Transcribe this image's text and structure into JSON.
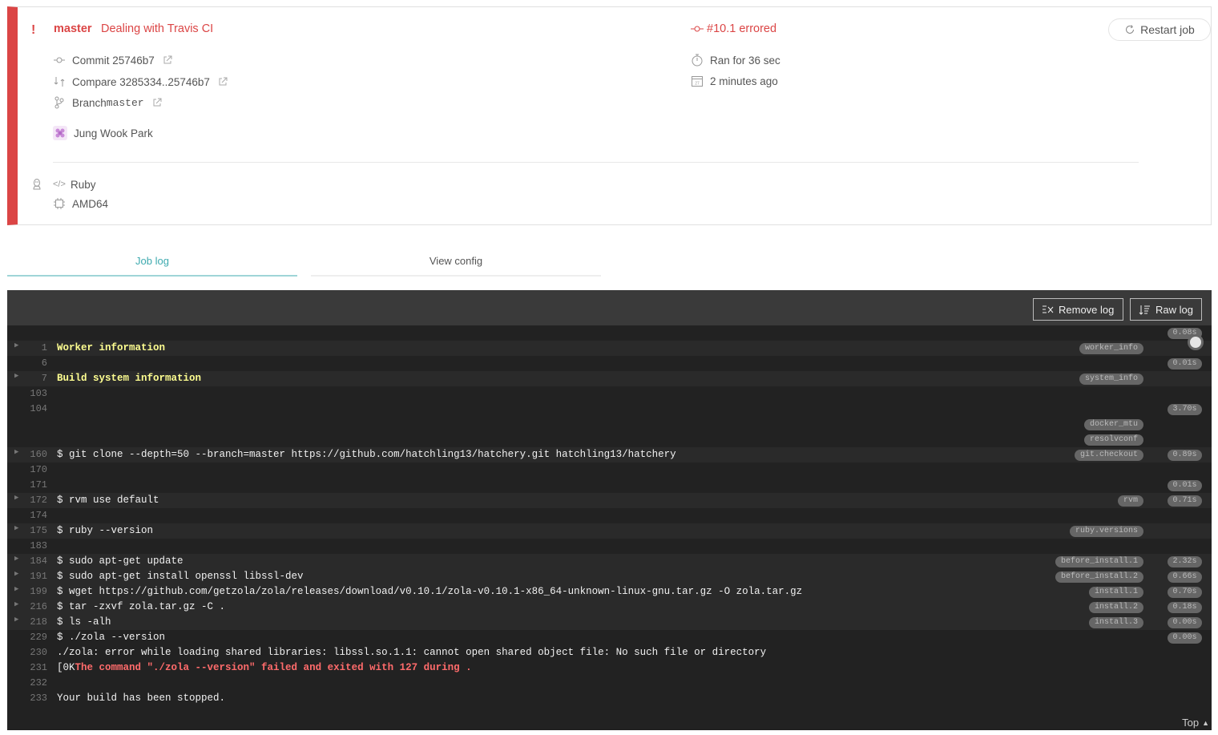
{
  "job": {
    "status_mark": "!",
    "branch": "master",
    "message": "Dealing with Travis CI",
    "number": "#10.1 errored",
    "commit_label": "Commit 25746b7",
    "compare_label": "Compare 3285334..25746b7",
    "branch_prefix": "Branch ",
    "branch_value": "master",
    "author": "Jung Wook Park",
    "duration": "Ran for 36 sec",
    "finished": "2 minutes ago",
    "language": "Ruby",
    "arch": "AMD64",
    "restart_label": "Restart job"
  },
  "colors": {
    "error": "#db4545",
    "tab_active": "#3eaaaf",
    "log_bg": "#222222"
  },
  "tabs": {
    "log": "Job log",
    "config": "View config"
  },
  "log": {
    "remove_label": "Remove log",
    "raw_label": "Raw log",
    "top_label": "Top",
    "lines": [
      {
        "n": "",
        "text": "",
        "time": "0.08s"
      },
      {
        "n": "1",
        "text": "Worker information",
        "style": "yellow",
        "fold": true,
        "tag": "worker_info"
      },
      {
        "n": "6",
        "text": "",
        "time": "0.01s"
      },
      {
        "n": "7",
        "text": "Build system information",
        "style": "yellow",
        "fold": true,
        "tag": "system_info"
      },
      {
        "n": "103",
        "text": ""
      },
      {
        "n": "104",
        "text": "",
        "time": "3.70s"
      },
      {
        "n": "",
        "text": "",
        "tag": "docker_mtu"
      },
      {
        "n": "",
        "text": "",
        "tag": "resolvconf"
      },
      {
        "n": "160",
        "text": "$ git clone --depth=50 --branch=master https://github.com/hatchling13/hatchery.git hatchling13/hatchery",
        "fold": true,
        "tag": "git.checkout",
        "time": "0.89s"
      },
      {
        "n": "170",
        "text": ""
      },
      {
        "n": "171",
        "text": "",
        "time": "0.01s"
      },
      {
        "n": "172",
        "text": "$ rvm use default",
        "fold": true,
        "tag": "rvm",
        "time": "0.71s"
      },
      {
        "n": "174",
        "text": ""
      },
      {
        "n": "175",
        "text": "$ ruby --version",
        "fold": true,
        "tag": "ruby.versions"
      },
      {
        "n": "183",
        "text": ""
      },
      {
        "n": "184",
        "text": "$ sudo apt-get update",
        "fold": true,
        "tag": "before_install.1",
        "time": "2.32s"
      },
      {
        "n": "191",
        "text": "$ sudo apt-get install openssl libssl-dev",
        "fold": true,
        "tag": "before_install.2",
        "time": "0.66s"
      },
      {
        "n": "199",
        "text": "$ wget https://github.com/getzola/zola/releases/download/v0.10.1/zola-v0.10.1-x86_64-unknown-linux-gnu.tar.gz -O zola.tar.gz",
        "fold": true,
        "tag": "install.1",
        "time": "0.70s"
      },
      {
        "n": "216",
        "text": "$ tar -zxvf zola.tar.gz -C .",
        "fold": true,
        "tag": "install.2",
        "time": "0.18s"
      },
      {
        "n": "218",
        "text": "$ ls -alh",
        "fold": true,
        "tag": "install.3",
        "time": "0.00s"
      },
      {
        "n": "229",
        "text": "$ ./zola --version",
        "time": "0.00s"
      },
      {
        "n": "230",
        "text": "./zola: error while loading shared libraries: libssl.so.1.1: cannot open shared object file: No such file or directory"
      },
      {
        "n": "231",
        "prefix": "[0K",
        "text": "The command \"./zola --version\" failed and exited with 127 during .",
        "style": "red"
      },
      {
        "n": "232",
        "text": ""
      },
      {
        "n": "233",
        "text": "Your build has been stopped."
      }
    ]
  }
}
